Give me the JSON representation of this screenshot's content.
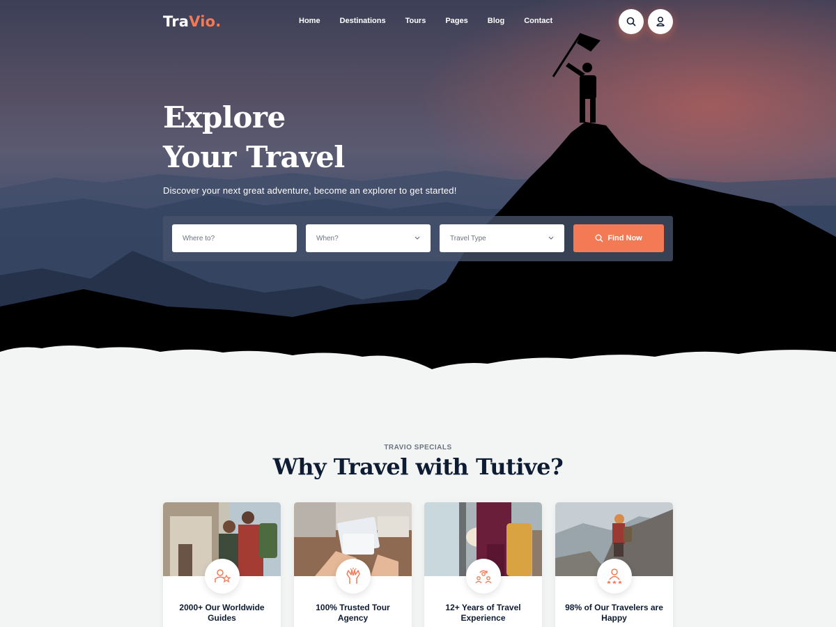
{
  "brand": {
    "name_main": "Tra",
    "name_accent": "Vio",
    "dot": ".",
    "accent_color": "#f47a55"
  },
  "nav": {
    "items": [
      {
        "label": "Home"
      },
      {
        "label": "Destinations"
      },
      {
        "label": "Tours"
      },
      {
        "label": "Pages"
      },
      {
        "label": "Blog"
      },
      {
        "label": "Contact"
      }
    ],
    "search_icon": "search-icon",
    "user_icon": "user-icon"
  },
  "hero": {
    "title_line1": "Explore",
    "title_line2": "Your Travel",
    "subtitle": "Discover your next great adventure, become an explorer to get started!"
  },
  "search": {
    "where_placeholder": "Where to?",
    "when_value": "When?",
    "type_value": "Travel Type",
    "button_label": "Find Now"
  },
  "specials": {
    "eyebrow": "TRAVIO SPECIALS",
    "title": "Why Travel with Tutive?",
    "cards": [
      {
        "label": "2000+ Our Worldwide Guides",
        "icon": "guide-star-icon"
      },
      {
        "label": "100% Trusted Tour Agency",
        "icon": "high-five-icon"
      },
      {
        "label": "12+ Years of Travel Experience",
        "icon": "people-cycle-icon"
      },
      {
        "label": "98% of Our Travelers are Happy",
        "icon": "rating-stars-icon"
      }
    ]
  }
}
